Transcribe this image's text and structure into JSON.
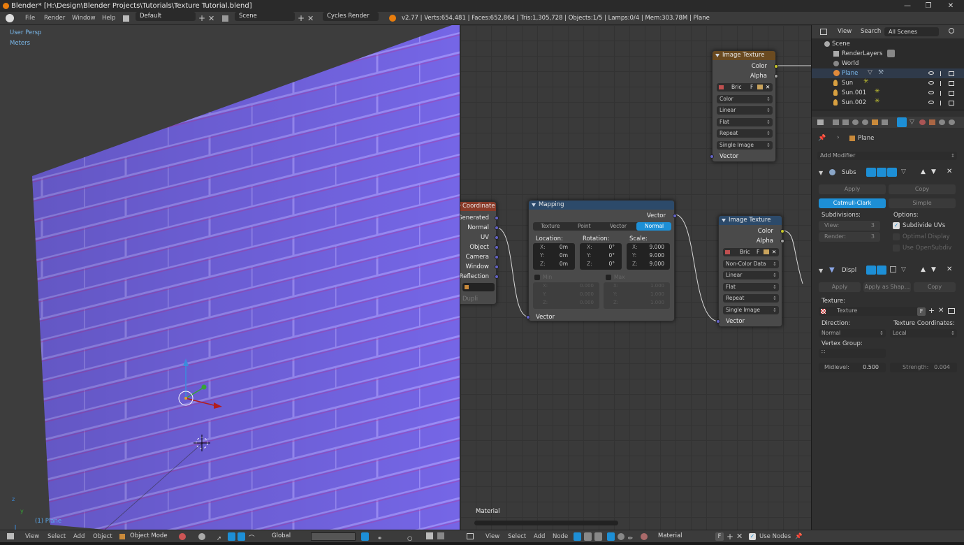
{
  "window": {
    "title": "Blender* [H:\\Design\\Blender Projects\\Tutorials\\Texture Tutorial.blend]"
  },
  "infobar": {
    "menus": [
      "File",
      "Render",
      "Window",
      "Help"
    ],
    "layout": "Default",
    "scene": "Scene",
    "engine": "Cycles Render",
    "stats": "v2.77 | Verts:654,481 | Faces:652,864 | Tris:1,305,728 | Objects:1/5 | Lamps:0/4 | Mem:303.78M | Plane"
  },
  "viewport": {
    "view_label": "User Persp",
    "units_label": "Meters",
    "object_label": "(1) Plane",
    "axis_z": "z",
    "axis_y": "y",
    "colors": {
      "wall_light": "#7d6cee",
      "wall_dark": "#5a48cc",
      "wall_side": "#6a5ad8"
    }
  },
  "node_editor": {
    "material_label": "Material",
    "texcoord_node": {
      "title": "Coordinate",
      "outputs": [
        "Generated",
        "Normal",
        "UV",
        "Object",
        "Camera",
        "Window",
        "Reflection"
      ],
      "dupli": "Dupli"
    },
    "mapping_node": {
      "title": "Mapping",
      "output": "Vector",
      "tabs": [
        "Texture",
        "Point",
        "Vector",
        "Normal"
      ],
      "active_tab": "Normal",
      "location_label": "Location:",
      "rotation_label": "Rotation:",
      "scale_label": "Scale:",
      "location": {
        "x": "0m",
        "y": "0m",
        "z": "0m"
      },
      "rotation": {
        "x": "0°",
        "y": "0°",
        "z": "0°"
      },
      "scale": {
        "x": "9.000",
        "y": "9.000",
        "z": "9.000"
      },
      "axis_x": "X:",
      "axis_y": "Y:",
      "axis_z": "Z:",
      "min_label": "Min",
      "max_label": "Max",
      "min": {
        "x": "0.000",
        "y": "0.000",
        "z": "0.000"
      },
      "max": {
        "x": "1.000",
        "y": "1.000",
        "z": "1.000"
      },
      "input": "Vector"
    },
    "image_texture_top": {
      "title": "Image Texture",
      "out_color": "Color",
      "out_alpha": "Alpha",
      "image": "Bric",
      "fake": "F",
      "dropdowns": [
        "Color",
        "Linear",
        "Flat",
        "Repeat",
        "Single Image"
      ],
      "input": "Vector"
    },
    "image_texture_bottom": {
      "title": "Image Texture",
      "out_color": "Color",
      "out_alpha": "Alpha",
      "image": "Bric",
      "fake": "F",
      "dropdowns": [
        "Non-Color Data",
        "Linear",
        "Flat",
        "Repeat",
        "Single Image"
      ],
      "input": "Vector"
    }
  },
  "outliner": {
    "menu_view": "View",
    "menu_search": "Search",
    "filter": "All Scenes",
    "items": [
      "Scene",
      "RenderLayers",
      "World",
      "Plane",
      "Sun",
      "Sun.001",
      "Sun.002"
    ]
  },
  "properties": {
    "object_name": "Plane",
    "add_modifier": "Add Modifier",
    "subsurf": {
      "name": "Subs",
      "apply": "Apply",
      "copy": "Copy",
      "mode_active": "Catmull-Clark",
      "mode_other": "Simple",
      "subdivisions_label": "Subdivisions:",
      "options_label": "Options:",
      "view_label": "View:",
      "view_value": "3",
      "render_label": "Render:",
      "render_value": "3",
      "opt1": "Subdivide UVs",
      "opt2": "Optimal Display",
      "opt3": "Use OpenSubdiv"
    },
    "displace": {
      "name": "Displ",
      "apply": "Apply",
      "apply_shape": "Apply as Shap...",
      "copy": "Copy",
      "texture_label": "Texture:",
      "texture_name": "Texture",
      "texture_fake": "F",
      "direction_label": "Direction:",
      "direction_value": "Normal",
      "coords_label": "Texture Coordinates:",
      "coords_value": "Local",
      "vgroup_label": "Vertex Group:",
      "midlevel_label": "Midlevel:",
      "midlevel_value": "0.500",
      "strength_label": "Strength:",
      "strength_value": "0.004"
    }
  },
  "bottombar": {
    "view": "View",
    "select": "Select",
    "add": "Add",
    "object": "Object",
    "mode": "Object Mode",
    "orientation": "Global",
    "ne_view": "View",
    "ne_select": "Select",
    "ne_add": "Add",
    "ne_node": "Node",
    "material": "Material",
    "fake": "F",
    "use_nodes": "Use Nodes"
  }
}
